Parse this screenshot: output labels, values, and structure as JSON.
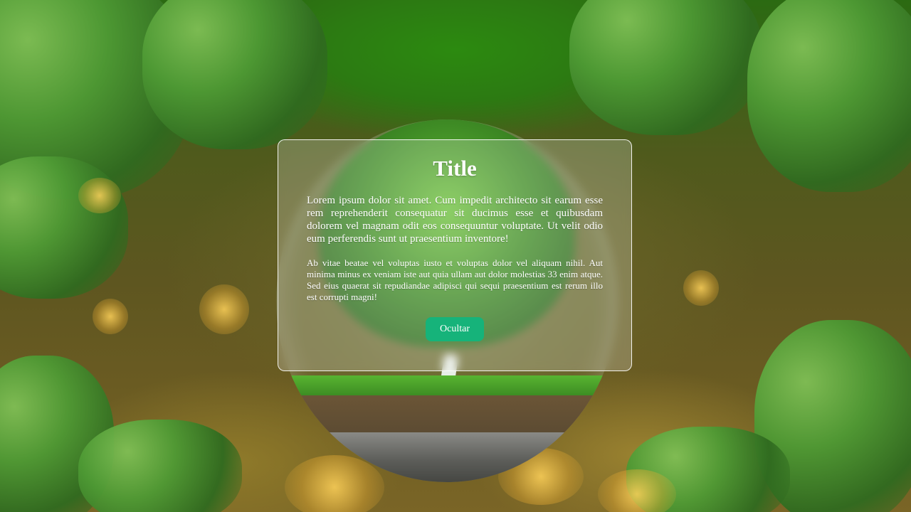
{
  "card": {
    "title": "Title",
    "paragraph_1": "Lorem ipsum dolor sit amet. Cum impedit architecto sit earum esse rem reprehenderit consequatur sit ducimus esse et quibusdam dolorem vel magnam odit eos consequuntur voluptate. Ut velit odio eum perferendis sunt ut praesentium inventore!",
    "paragraph_2": "Ab vitae beatae vel voluptas iusto et voluptas dolor vel aliquam nihil. Aut minima minus ex veniam iste aut quia ullam aut dolor molestias 33 enim atque. Sed eius quaerat sit repudiandae adipisci qui sequi praesentium est rerum illo est corrupti magni!",
    "button_label": "Ocultar"
  },
  "colors": {
    "button": "#16b37a",
    "text": "#ffffff"
  }
}
